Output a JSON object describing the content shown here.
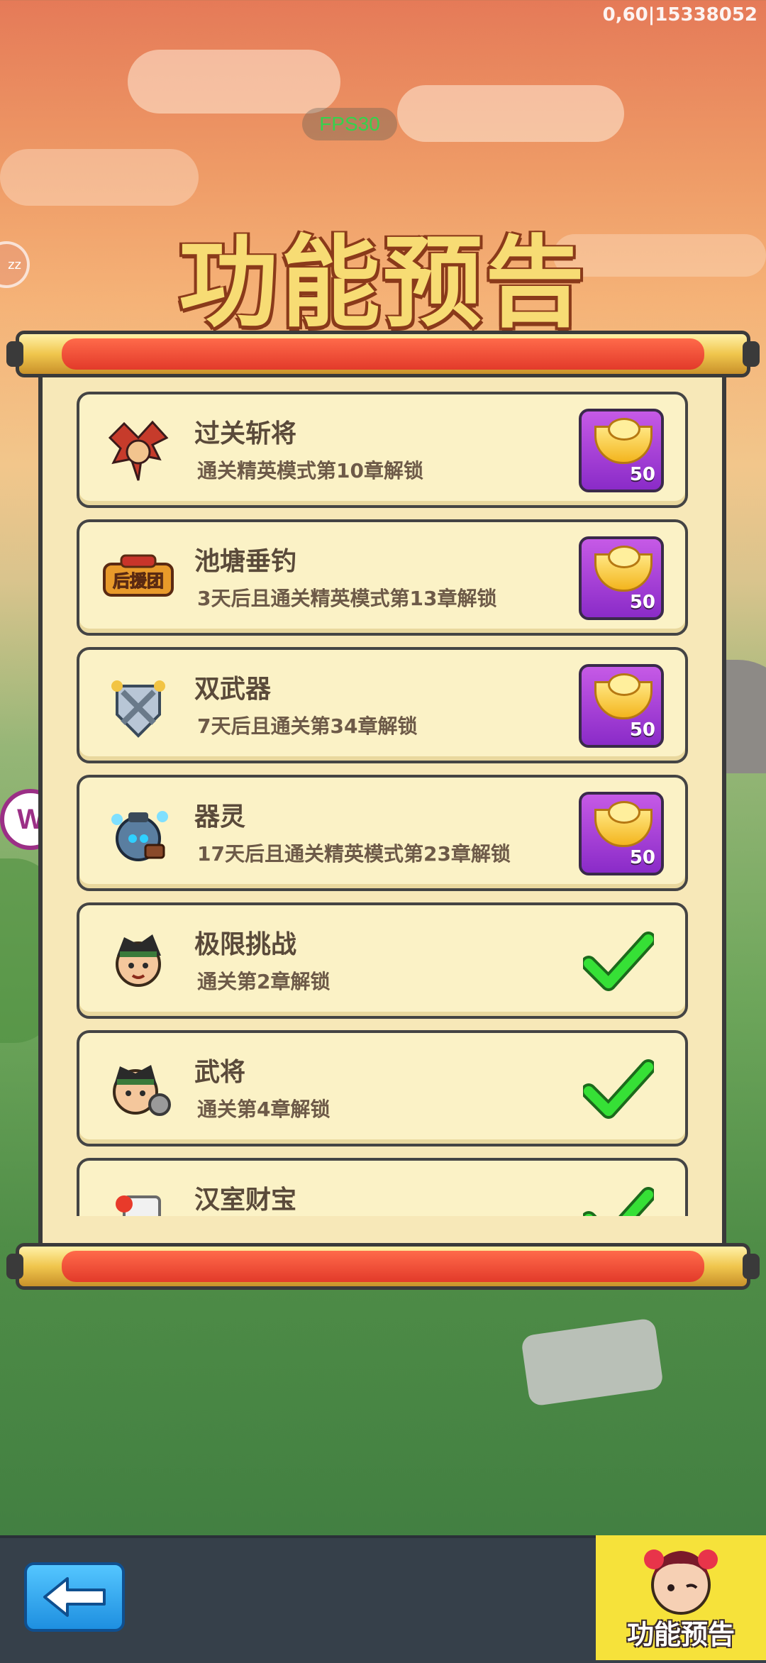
{
  "status": {
    "perf_text": "0,60|15338052",
    "fps_label": "FPS30",
    "side_bubble_text": "zz"
  },
  "title": "功能预告",
  "features": [
    {
      "name": "过关斩将",
      "desc": "通关精英模式第10章解锁",
      "state": "reward",
      "reward_count": "50",
      "icon": "warrior-dragon-icon"
    },
    {
      "name": "池塘垂钓",
      "desc": "3天后且通关精英模式第13章解锁",
      "state": "reward",
      "reward_count": "50",
      "icon": "banner-houyuantuan-icon",
      "icon_text": "后援团"
    },
    {
      "name": "双武器",
      "desc": "7天后且通关第34章解锁",
      "state": "reward",
      "reward_count": "50",
      "icon": "crossed-swords-shield-icon"
    },
    {
      "name": "器灵",
      "desc": "17天后且通关精英模式第23章解锁",
      "state": "reward",
      "reward_count": "50",
      "icon": "spirit-pot-icon"
    },
    {
      "name": "极限挑战",
      "desc": "通关第2章解锁",
      "state": "unlocked",
      "icon": "hero-portrait-icon"
    },
    {
      "name": "武将",
      "desc": "通关第4章解锁",
      "state": "unlocked",
      "icon": "general-portrait-icon"
    },
    {
      "name": "汉室财宝",
      "desc": "",
      "state": "unlocked",
      "icon": "treasure-scroll-icon"
    }
  ],
  "bottom": {
    "preview_label": "功能预告"
  },
  "colors": {
    "reward_purple": "#a844d8",
    "check_green": "#2fd62f",
    "scroll_paper": "#f7e8b8"
  }
}
